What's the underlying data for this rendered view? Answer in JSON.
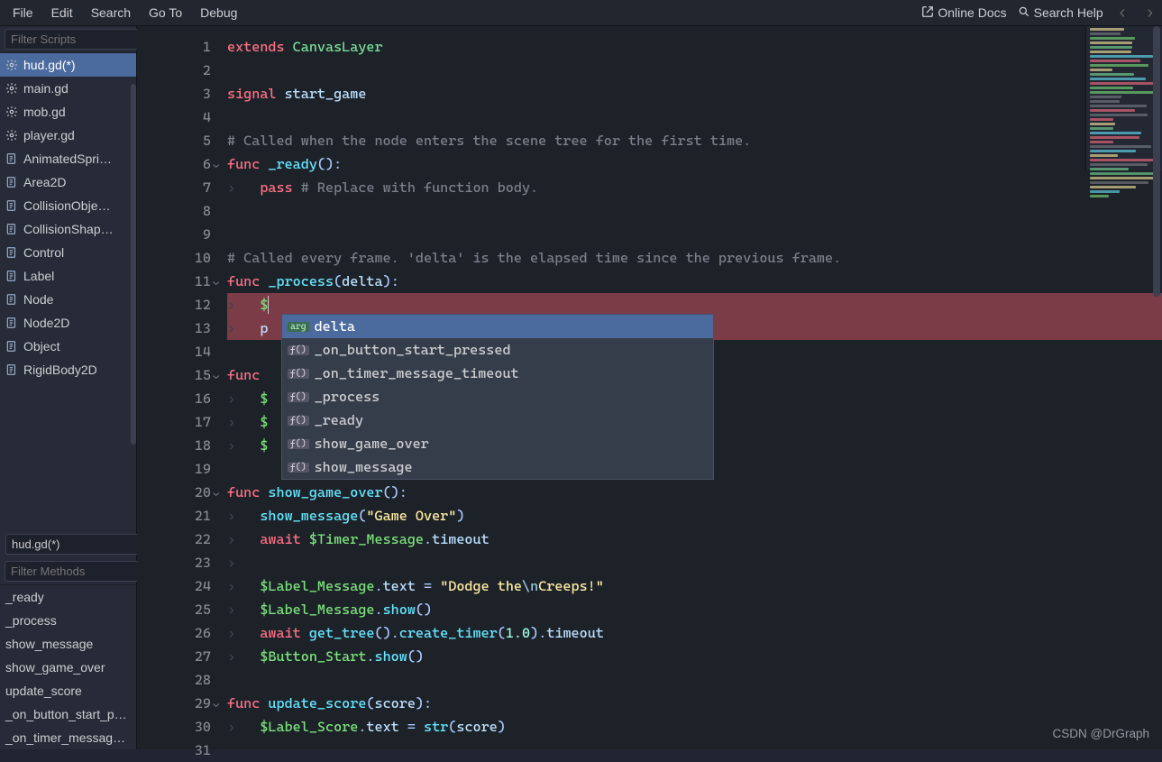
{
  "menu": {
    "left": [
      "File",
      "Edit",
      "Search",
      "Go To",
      "Debug"
    ],
    "online_docs": "Online Docs",
    "search_help": "Search Help"
  },
  "filters": {
    "filter_scripts_ph": "Filter Scripts",
    "filter_methods_ph": "Filter Methods"
  },
  "scripts": [
    {
      "label": "hud.gd(*)",
      "icon": "gear",
      "active": true
    },
    {
      "label": "main.gd",
      "icon": "gear"
    },
    {
      "label": "mob.gd",
      "icon": "gear"
    },
    {
      "label": "player.gd",
      "icon": "gear"
    },
    {
      "label": "AnimatedSpri…",
      "icon": "doc"
    },
    {
      "label": "Area2D",
      "icon": "doc"
    },
    {
      "label": "CollisionObje…",
      "icon": "doc"
    },
    {
      "label": "CollisionShap…",
      "icon": "doc"
    },
    {
      "label": "Control",
      "icon": "doc"
    },
    {
      "label": "Label",
      "icon": "doc"
    },
    {
      "label": "Node",
      "icon": "doc"
    },
    {
      "label": "Node2D",
      "icon": "doc"
    },
    {
      "label": "Object",
      "icon": "doc"
    },
    {
      "label": "RigidBody2D",
      "icon": "doc"
    }
  ],
  "current_script": "hud.gd(*)",
  "methods": [
    "_ready",
    "_process",
    "show_message",
    "show_game_over",
    "update_score",
    "_on_button_start_p…",
    "_on_timer_messag…"
  ],
  "code": {
    "lines": [
      {
        "n": 1,
        "seg": [
          [
            "kw",
            "extends"
          ],
          [
            "",
            ""
          ],
          [
            "type",
            " CanvasLayer"
          ]
        ]
      },
      {
        "n": 2,
        "seg": []
      },
      {
        "n": 3,
        "seg": [
          [
            "kw",
            "signal"
          ],
          [
            "",
            " "
          ],
          [
            "var",
            "start_game"
          ]
        ]
      },
      {
        "n": 4,
        "seg": []
      },
      {
        "n": 5,
        "seg": [
          [
            "cmt",
            "# Called when the node enters the scene tree for the first time."
          ]
        ]
      },
      {
        "n": 6,
        "fold": true,
        "seg": [
          [
            "kw",
            "func"
          ],
          [
            "",
            " "
          ],
          [
            "fn",
            "_ready"
          ],
          [
            "op",
            "()"
          ],
          [
            "op",
            ":"
          ]
        ]
      },
      {
        "n": 7,
        "indent": 1,
        "seg": [
          [
            "kw",
            "pass"
          ],
          [
            "",
            " "
          ],
          [
            "cmt",
            "# Replace with function body."
          ]
        ]
      },
      {
        "n": 8,
        "seg": []
      },
      {
        "n": 9,
        "seg": []
      },
      {
        "n": 10,
        "seg": [
          [
            "cmt",
            "# Called every frame. 'delta' is the elapsed time since the previous frame."
          ]
        ]
      },
      {
        "n": 11,
        "fold": true,
        "seg": [
          [
            "kw",
            "func"
          ],
          [
            "",
            " "
          ],
          [
            "fn",
            "_process"
          ],
          [
            "op",
            "("
          ],
          [
            "var",
            "delta"
          ],
          [
            "op",
            ")"
          ],
          [
            "op",
            ":"
          ]
        ]
      },
      {
        "n": 12,
        "indent": 1,
        "hl": true,
        "seg": [
          [
            "node",
            "$"
          ]
        ],
        "cursor": true
      },
      {
        "n": 13,
        "indent": 1,
        "hl": true,
        "seg": [
          [
            "var",
            "p"
          ]
        ]
      },
      {
        "n": 14,
        "seg": []
      },
      {
        "n": 15,
        "fold": true,
        "seg": [
          [
            "kw",
            "func"
          ],
          [
            "",
            " "
          ]
        ]
      },
      {
        "n": 16,
        "indent": 1,
        "seg": [
          [
            "node",
            "$"
          ]
        ]
      },
      {
        "n": 17,
        "indent": 1,
        "seg": [
          [
            "node",
            "$"
          ]
        ]
      },
      {
        "n": 18,
        "indent": 1,
        "seg": [
          [
            "node",
            "$"
          ]
        ]
      },
      {
        "n": 19,
        "seg": []
      },
      {
        "n": 20,
        "fold": true,
        "seg": [
          [
            "kw",
            "func"
          ],
          [
            "",
            " "
          ],
          [
            "fn",
            "show_game_over"
          ],
          [
            "op",
            "()"
          ],
          [
            "op",
            ":"
          ]
        ]
      },
      {
        "n": 21,
        "indent": 1,
        "seg": [
          [
            "call",
            "show_message"
          ],
          [
            "op",
            "("
          ],
          [
            "str",
            "\"Game Over\""
          ],
          [
            "op",
            ")"
          ]
        ]
      },
      {
        "n": 22,
        "indent": 1,
        "seg": [
          [
            "kw",
            "await"
          ],
          [
            "",
            " "
          ],
          [
            "node",
            "$Timer_Message"
          ],
          [
            "op",
            "."
          ],
          [
            "var",
            "timeout"
          ]
        ]
      },
      {
        "n": 23,
        "indent": 1,
        "seg": []
      },
      {
        "n": 24,
        "indent": 1,
        "seg": [
          [
            "node",
            "$Label_Message"
          ],
          [
            "op",
            "."
          ],
          [
            "var",
            "text"
          ],
          [
            "",
            " "
          ],
          [
            "op",
            "="
          ],
          [
            "",
            " "
          ],
          [
            "str",
            "\"Dodge the"
          ],
          [
            "esc",
            "\\n"
          ],
          [
            "str",
            "Creeps!\""
          ]
        ]
      },
      {
        "n": 25,
        "indent": 1,
        "seg": [
          [
            "node",
            "$Label_Message"
          ],
          [
            "op",
            "."
          ],
          [
            "call",
            "show"
          ],
          [
            "op",
            "()"
          ]
        ]
      },
      {
        "n": 26,
        "indent": 1,
        "seg": [
          [
            "kw",
            "await"
          ],
          [
            "",
            " "
          ],
          [
            "call",
            "get_tree"
          ],
          [
            "op",
            "()"
          ],
          [
            "op",
            "."
          ],
          [
            "call",
            "create_timer"
          ],
          [
            "op",
            "("
          ],
          [
            "num",
            "1.0"
          ],
          [
            "op",
            ")"
          ],
          [
            "op",
            "."
          ],
          [
            "var",
            "timeout"
          ]
        ]
      },
      {
        "n": 27,
        "indent": 1,
        "seg": [
          [
            "node",
            "$Button_Start"
          ],
          [
            "op",
            "."
          ],
          [
            "call",
            "show"
          ],
          [
            "op",
            "()"
          ]
        ]
      },
      {
        "n": 28,
        "seg": []
      },
      {
        "n": 29,
        "fold": true,
        "seg": [
          [
            "kw",
            "func"
          ],
          [
            "",
            " "
          ],
          [
            "fn",
            "update_score"
          ],
          [
            "op",
            "("
          ],
          [
            "var",
            "score"
          ],
          [
            "op",
            ")"
          ],
          [
            "op",
            ":"
          ]
        ]
      },
      {
        "n": 30,
        "indent": 1,
        "seg": [
          [
            "node",
            "$Label_Score"
          ],
          [
            "op",
            "."
          ],
          [
            "var",
            "text"
          ],
          [
            "",
            " "
          ],
          [
            "op",
            "="
          ],
          [
            "",
            " "
          ],
          [
            "call",
            "str"
          ],
          [
            "op",
            "("
          ],
          [
            "var",
            "score"
          ],
          [
            "op",
            ")"
          ]
        ]
      },
      {
        "n": 31,
        "seg": []
      }
    ]
  },
  "autocomplete": {
    "top_line": 13,
    "items": [
      {
        "kind": "arg",
        "label": "delta",
        "sel": true
      },
      {
        "kind": "fn",
        "label": "_on_button_start_pressed"
      },
      {
        "kind": "fn",
        "label": "_on_timer_message_timeout"
      },
      {
        "kind": "fn",
        "label": "_process"
      },
      {
        "kind": "fn",
        "label": "_ready"
      },
      {
        "kind": "fn",
        "label": "show_game_over"
      },
      {
        "kind": "fn",
        "label": "show_message"
      }
    ]
  },
  "watermark": "CSDN @DrGraph"
}
